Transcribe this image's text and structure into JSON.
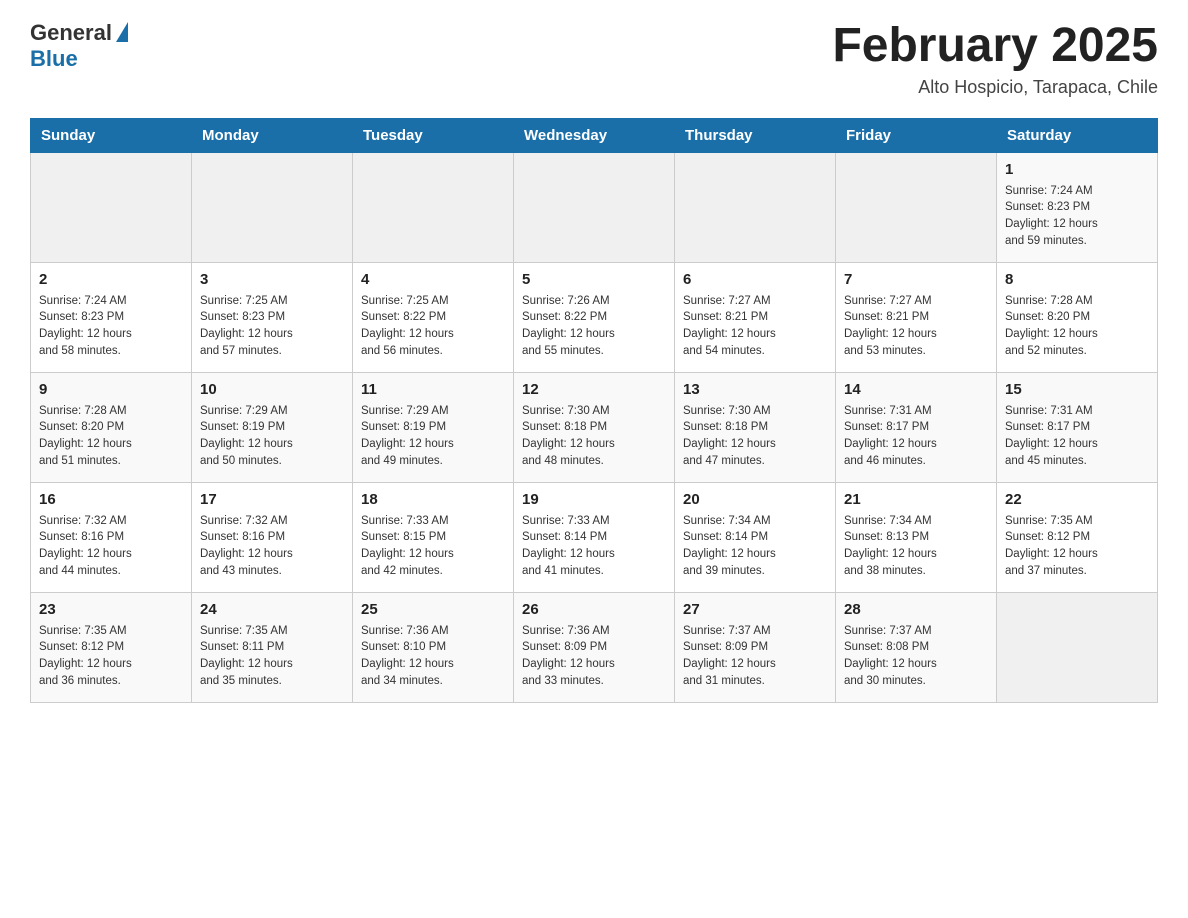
{
  "header": {
    "logo_general": "General",
    "logo_blue": "Blue",
    "month_title": "February 2025",
    "location": "Alto Hospicio, Tarapaca, Chile"
  },
  "days_of_week": [
    "Sunday",
    "Monday",
    "Tuesday",
    "Wednesday",
    "Thursday",
    "Friday",
    "Saturday"
  ],
  "weeks": [
    [
      {
        "day": "",
        "info": ""
      },
      {
        "day": "",
        "info": ""
      },
      {
        "day": "",
        "info": ""
      },
      {
        "day": "",
        "info": ""
      },
      {
        "day": "",
        "info": ""
      },
      {
        "day": "",
        "info": ""
      },
      {
        "day": "1",
        "info": "Sunrise: 7:24 AM\nSunset: 8:23 PM\nDaylight: 12 hours\nand 59 minutes."
      }
    ],
    [
      {
        "day": "2",
        "info": "Sunrise: 7:24 AM\nSunset: 8:23 PM\nDaylight: 12 hours\nand 58 minutes."
      },
      {
        "day": "3",
        "info": "Sunrise: 7:25 AM\nSunset: 8:23 PM\nDaylight: 12 hours\nand 57 minutes."
      },
      {
        "day": "4",
        "info": "Sunrise: 7:25 AM\nSunset: 8:22 PM\nDaylight: 12 hours\nand 56 minutes."
      },
      {
        "day": "5",
        "info": "Sunrise: 7:26 AM\nSunset: 8:22 PM\nDaylight: 12 hours\nand 55 minutes."
      },
      {
        "day": "6",
        "info": "Sunrise: 7:27 AM\nSunset: 8:21 PM\nDaylight: 12 hours\nand 54 minutes."
      },
      {
        "day": "7",
        "info": "Sunrise: 7:27 AM\nSunset: 8:21 PM\nDaylight: 12 hours\nand 53 minutes."
      },
      {
        "day": "8",
        "info": "Sunrise: 7:28 AM\nSunset: 8:20 PM\nDaylight: 12 hours\nand 52 minutes."
      }
    ],
    [
      {
        "day": "9",
        "info": "Sunrise: 7:28 AM\nSunset: 8:20 PM\nDaylight: 12 hours\nand 51 minutes."
      },
      {
        "day": "10",
        "info": "Sunrise: 7:29 AM\nSunset: 8:19 PM\nDaylight: 12 hours\nand 50 minutes."
      },
      {
        "day": "11",
        "info": "Sunrise: 7:29 AM\nSunset: 8:19 PM\nDaylight: 12 hours\nand 49 minutes."
      },
      {
        "day": "12",
        "info": "Sunrise: 7:30 AM\nSunset: 8:18 PM\nDaylight: 12 hours\nand 48 minutes."
      },
      {
        "day": "13",
        "info": "Sunrise: 7:30 AM\nSunset: 8:18 PM\nDaylight: 12 hours\nand 47 minutes."
      },
      {
        "day": "14",
        "info": "Sunrise: 7:31 AM\nSunset: 8:17 PM\nDaylight: 12 hours\nand 46 minutes."
      },
      {
        "day": "15",
        "info": "Sunrise: 7:31 AM\nSunset: 8:17 PM\nDaylight: 12 hours\nand 45 minutes."
      }
    ],
    [
      {
        "day": "16",
        "info": "Sunrise: 7:32 AM\nSunset: 8:16 PM\nDaylight: 12 hours\nand 44 minutes."
      },
      {
        "day": "17",
        "info": "Sunrise: 7:32 AM\nSunset: 8:16 PM\nDaylight: 12 hours\nand 43 minutes."
      },
      {
        "day": "18",
        "info": "Sunrise: 7:33 AM\nSunset: 8:15 PM\nDaylight: 12 hours\nand 42 minutes."
      },
      {
        "day": "19",
        "info": "Sunrise: 7:33 AM\nSunset: 8:14 PM\nDaylight: 12 hours\nand 41 minutes."
      },
      {
        "day": "20",
        "info": "Sunrise: 7:34 AM\nSunset: 8:14 PM\nDaylight: 12 hours\nand 39 minutes."
      },
      {
        "day": "21",
        "info": "Sunrise: 7:34 AM\nSunset: 8:13 PM\nDaylight: 12 hours\nand 38 minutes."
      },
      {
        "day": "22",
        "info": "Sunrise: 7:35 AM\nSunset: 8:12 PM\nDaylight: 12 hours\nand 37 minutes."
      }
    ],
    [
      {
        "day": "23",
        "info": "Sunrise: 7:35 AM\nSunset: 8:12 PM\nDaylight: 12 hours\nand 36 minutes."
      },
      {
        "day": "24",
        "info": "Sunrise: 7:35 AM\nSunset: 8:11 PM\nDaylight: 12 hours\nand 35 minutes."
      },
      {
        "day": "25",
        "info": "Sunrise: 7:36 AM\nSunset: 8:10 PM\nDaylight: 12 hours\nand 34 minutes."
      },
      {
        "day": "26",
        "info": "Sunrise: 7:36 AM\nSunset: 8:09 PM\nDaylight: 12 hours\nand 33 minutes."
      },
      {
        "day": "27",
        "info": "Sunrise: 7:37 AM\nSunset: 8:09 PM\nDaylight: 12 hours\nand 31 minutes."
      },
      {
        "day": "28",
        "info": "Sunrise: 7:37 AM\nSunset: 8:08 PM\nDaylight: 12 hours\nand 30 minutes."
      },
      {
        "day": "",
        "info": ""
      }
    ]
  ]
}
